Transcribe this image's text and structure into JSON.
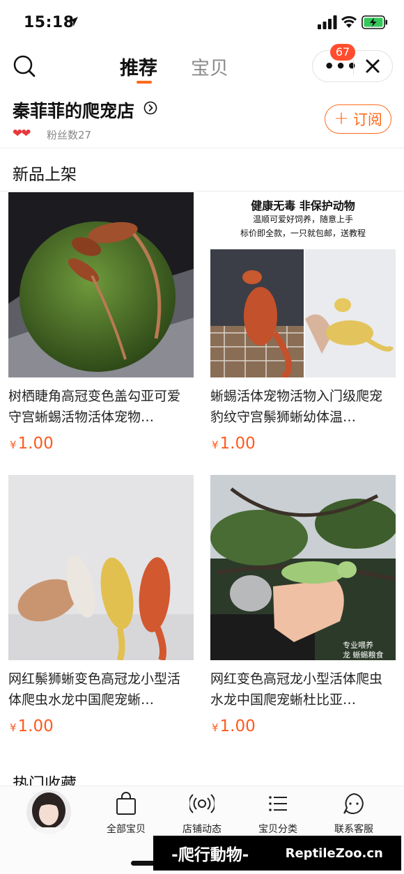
{
  "status_bar": {
    "time": "15:18"
  },
  "header": {
    "tabs": [
      {
        "label": "推荐",
        "active": true
      },
      {
        "label": "宝贝",
        "active": false
      }
    ],
    "more_label": "•••",
    "badge_count": "67"
  },
  "shop": {
    "name": "秦菲菲的爬宠店",
    "hearts": "❤❤",
    "fans": "粉丝数27",
    "subscribe_label": "订阅"
  },
  "sections": {
    "new_arrivals": "新品上架",
    "popular": "热门收藏"
  },
  "products": [
    {
      "title": "树栖睫角高冠变色盖勾亚可爱守宫蜥蜴活物活体宠物…",
      "currency": "¥",
      "price": "1.00"
    },
    {
      "title": "蜥蜴活体宠物活物入门级爬宠豹纹守宫鬃狮蜥幼体温…",
      "currency": "¥",
      "price": "1.00",
      "image_text": [
        "健康无毒 非保护动物",
        "温顺可爱好饲养，随意上手",
        "标价即全款，一只就包邮，送教程"
      ]
    },
    {
      "title": "网红鬃狮蜥变色高冠龙小型活体爬虫水龙中国爬宠蜥…",
      "currency": "¥",
      "price": "1.00"
    },
    {
      "title": "网红变色高冠龙小型活体爬虫水龙中国爬宠蜥杜比亚…",
      "currency": "¥",
      "price": "1.00",
      "image_text": [
        "专业喂养",
        "龙 蜥蜴粮食"
      ]
    }
  ],
  "bottom_nav": [
    {
      "label": "全部宝贝",
      "icon": "shopping-bag-icon"
    },
    {
      "label": "店铺动态",
      "icon": "broadcast-icon"
    },
    {
      "label": "宝贝分类",
      "icon": "list-icon"
    },
    {
      "label": "联系客服",
      "icon": "chat-icon"
    }
  ],
  "watermark": {
    "left": "-爬行動物-",
    "right": "ReptileZoo.cn"
  },
  "colors": {
    "accent": "#ff6a1a",
    "price": "#ff5a1f",
    "badge": "#ff4d2e"
  }
}
